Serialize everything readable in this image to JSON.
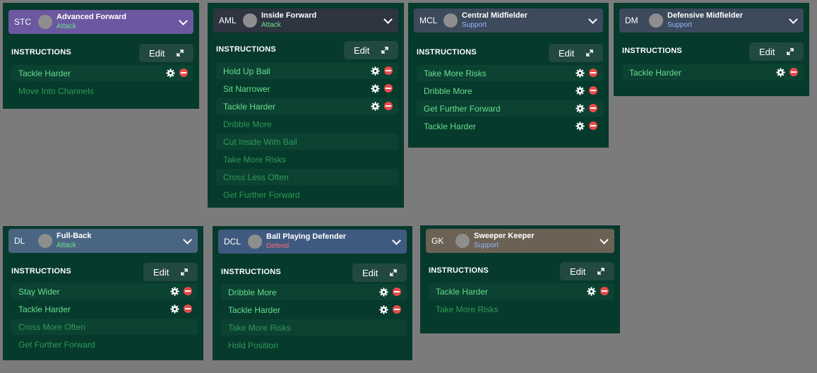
{
  "colors": {
    "attack_header": "#6b58a0",
    "attack_header_alt": "#2e3440",
    "support_header": "#3d4a5c",
    "fullback_header": "#4a6582",
    "defend_header": "#3f5a80",
    "keeper_header": "#6b6155",
    "attack_duty": "#6be28f",
    "support_duty": "#8fb8ff",
    "defend_duty": "#ff6b6b",
    "panel_bg": "#063a2c"
  },
  "panels": [
    {
      "position": "STC",
      "role": "Advanced Forward",
      "duty": "Attack",
      "instructions_title": "INSTRUCTIONS",
      "edit_label": "Edit",
      "items": [
        {
          "label": "Tackle Harder",
          "active": true
        },
        {
          "label": "Move Into Channels",
          "active": false
        }
      ]
    },
    {
      "position": "AML",
      "role": "Inside Forward",
      "duty": "Attack",
      "instructions_title": "INSTRUCTIONS",
      "edit_label": "Edit",
      "items": [
        {
          "label": "Hold Up Ball",
          "active": true
        },
        {
          "label": "Sit Narrower",
          "active": true
        },
        {
          "label": "Tackle Harder",
          "active": true
        },
        {
          "label": "Dribble More",
          "active": false
        },
        {
          "label": "Cut Inside With Ball",
          "active": false
        },
        {
          "label": "Take More Risks",
          "active": false
        },
        {
          "label": "Cross Less Often",
          "active": false
        },
        {
          "label": "Get Further Forward",
          "active": false
        }
      ]
    },
    {
      "position": "MCL",
      "role": "Central Midfielder",
      "duty": "Support",
      "instructions_title": "INSTRUCTIONS",
      "edit_label": "Edit",
      "items": [
        {
          "label": "Take More Risks",
          "active": true
        },
        {
          "label": "Dribble More",
          "active": true
        },
        {
          "label": "Get Further Forward",
          "active": true
        },
        {
          "label": "Tackle Harder",
          "active": true
        }
      ]
    },
    {
      "position": "DM",
      "role": "Defensive Midfielder",
      "duty": "Support",
      "instructions_title": "INSTRUCTIONS",
      "edit_label": "Edit",
      "items": [
        {
          "label": "Tackle Harder",
          "active": true
        }
      ]
    },
    {
      "position": "DL",
      "role": "Full-Back",
      "duty": "Attack",
      "instructions_title": "INSTRUCTIONS",
      "edit_label": "Edit",
      "items": [
        {
          "label": "Stay Wider",
          "active": true
        },
        {
          "label": "Tackle Harder",
          "active": true
        },
        {
          "label": "Cross More Often",
          "active": false
        },
        {
          "label": "Get Further Forward",
          "active": false
        }
      ]
    },
    {
      "position": "DCL",
      "role": "Ball Playing Defender",
      "duty": "Defend",
      "instructions_title": "INSTRUCTIONS",
      "edit_label": "Edit",
      "items": [
        {
          "label": "Dribble More",
          "active": true
        },
        {
          "label": "Tackle Harder",
          "active": true
        },
        {
          "label": "Take More Risks",
          "active": false
        },
        {
          "label": "Hold Position",
          "active": false
        }
      ]
    },
    {
      "position": "GK",
      "role": "Sweeper Keeper",
      "duty": "Support",
      "instructions_title": "INSTRUCTIONS",
      "edit_label": "Edit",
      "items": [
        {
          "label": "Tackle Harder",
          "active": true
        },
        {
          "label": "Take More Risks",
          "active": false
        }
      ]
    }
  ]
}
